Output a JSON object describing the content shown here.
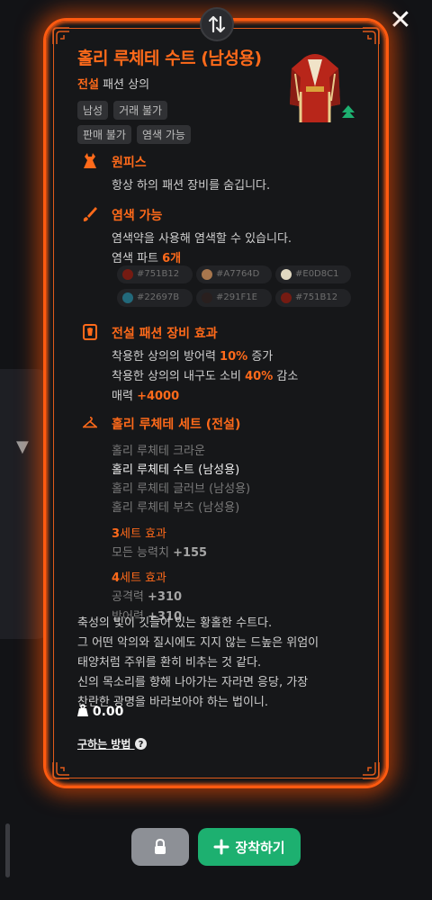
{
  "item": {
    "name": "홀리 루체테 수트 (남성용)",
    "grade": "전설",
    "category": "패션 상의",
    "tags": [
      "남성",
      "거래 불가",
      "판매 불가",
      "염색 가능"
    ]
  },
  "sections": {
    "onepiece": {
      "title": "원피스",
      "text": "항상 하의 패션 장비를 숨깁니다."
    },
    "dye": {
      "title": "염색 가능",
      "text": "염색약을 사용해 염색할 수 있습니다.",
      "parts_label": "염색 파트",
      "parts_count": "6개",
      "swatches": [
        {
          "hex": "#751B12",
          "color": "#751B12"
        },
        {
          "hex": "#A7764D",
          "color": "#A7764D"
        },
        {
          "hex": "#E0D8C1",
          "color": "#E0D8C1"
        },
        {
          "hex": "#22697B",
          "color": "#22697B"
        },
        {
          "hex": "#291F1E",
          "color": "#291F1E"
        },
        {
          "hex": "#751B12",
          "color": "#751B12"
        }
      ]
    },
    "legend_effect": {
      "title": "전설 패션 장비 효과",
      "line1_pre": "착용한 상의의 방어력",
      "line1_val": "10%",
      "line1_post": "증가",
      "line2_pre": "착용한 상의의 내구도 소비",
      "line2_val": "40%",
      "line2_post": "감소",
      "line3_pre": "매력",
      "line3_val": "+4000"
    },
    "set": {
      "title": "홀리 루체테 세트 (전설)",
      "pieces": [
        {
          "name": "홀리 루체테 크라운",
          "owned": false
        },
        {
          "name": "홀리 루체테 수트 (남성용)",
          "owned": true
        },
        {
          "name": "홀리 루체테 글러브 (남성용)",
          "owned": false
        },
        {
          "name": "홀리 루체테 부츠 (남성용)",
          "owned": false
        }
      ],
      "effect3_num": "3",
      "effect3_label": "세트 효과",
      "effect3_stat": "모든 능력치",
      "effect3_val": "+155",
      "effect4_num": "4",
      "effect4_label": "세트 효과",
      "effect4_stat1": "공격력",
      "effect4_val1": "+310",
      "effect4_stat2": "방어력",
      "effect4_val2": "+310"
    }
  },
  "description": [
    "축성의 빛이 깃들어 있는 황홀한 수트다.",
    "그 어떤 악의와 질시에도 지지 않는 드높은 위엄이",
    "태양처럼 주위를 환히 비추는 것 같다.",
    "신의 목소리를 향해 나아가는 자라면 응당, 가장",
    "찬란한 광명을 바라보아야 하는 법이니."
  ],
  "weight": "0.00",
  "how_to_get": "구하는 방법",
  "buttons": {
    "equip": "장착하기"
  },
  "colors": {
    "accent": "#ff6a1a",
    "frame_glow": "#ff5a10",
    "equip_green": "#1db070",
    "lock_gray": "#8d9096"
  },
  "icons": {
    "close": "close-icon",
    "swap": "swap-icon",
    "lock": "lock-icon",
    "plus": "plus-icon",
    "dress": "dress-icon",
    "brush": "brush-icon",
    "fashion_card": "fashion-card-icon",
    "hanger": "hanger-icon",
    "weight": "weight-icon",
    "help": "help-icon",
    "grade_up": "grade-up-icon"
  }
}
